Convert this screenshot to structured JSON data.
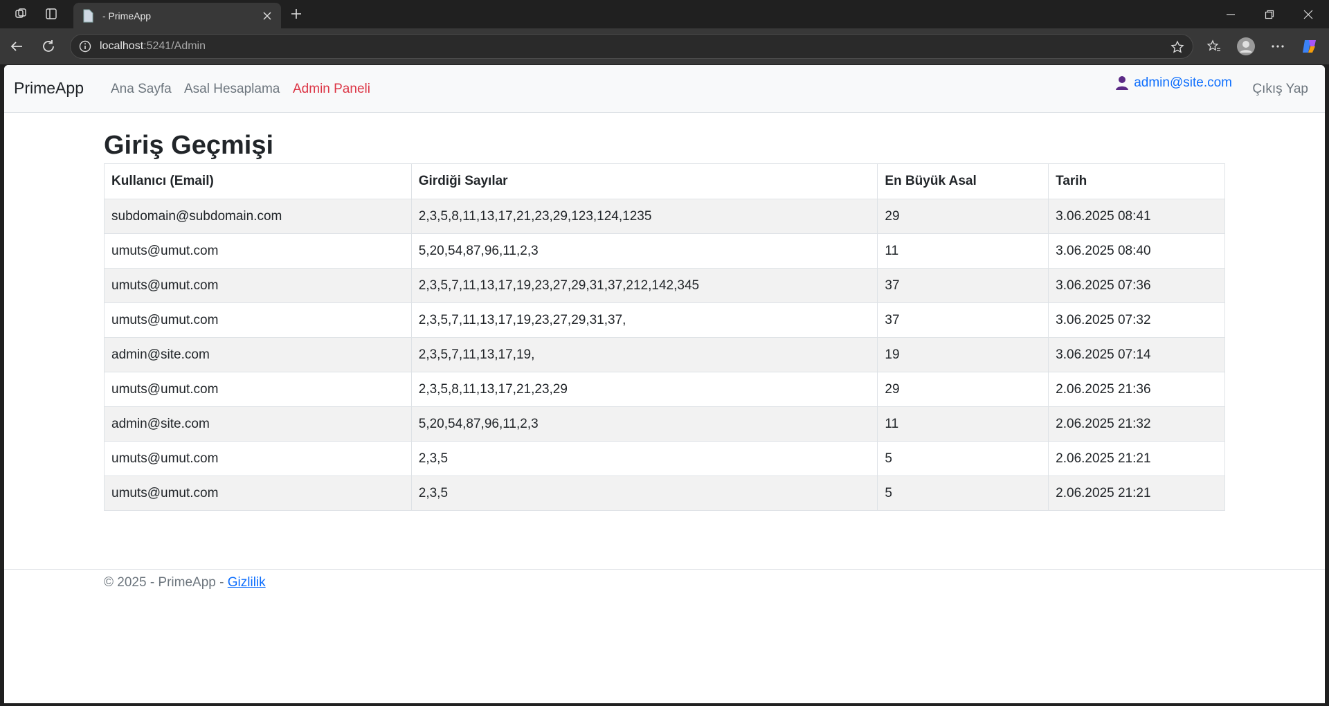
{
  "browser": {
    "tab_title": "- PrimeApp",
    "url_host": "localhost",
    "url_path": ":5241/Admin"
  },
  "navbar": {
    "brand": "PrimeApp",
    "links": [
      {
        "label": "Ana Sayfa",
        "active": false
      },
      {
        "label": "Asal Hesaplama",
        "active": false
      },
      {
        "label": "Admin Paneli",
        "active": true
      }
    ],
    "user_email": "admin@site.com",
    "logout_label": "Çıkış Yap",
    "active_color": "#dc3545",
    "link_color": "#0d6efd"
  },
  "main": {
    "title": "Giriş Geçmişi",
    "table": {
      "headers": [
        "Kullanıcı (Email)",
        "Girdiği Sayılar",
        "En Büyük Asal",
        "Tarih"
      ],
      "rows": [
        [
          "subdomain@subdomain.com",
          "2,3,5,8,11,13,17,21,23,29,123,124,1235",
          "29",
          "3.06.2025 08:41"
        ],
        [
          "umuts@umut.com",
          "5,20,54,87,96,11,2,3",
          "11",
          "3.06.2025 08:40"
        ],
        [
          "umuts@umut.com",
          "2,3,5,7,11,13,17,19,23,27,29,31,37,212,142,345",
          "37",
          "3.06.2025 07:36"
        ],
        [
          "umuts@umut.com",
          "2,3,5,7,11,13,17,19,23,27,29,31,37,",
          "37",
          "3.06.2025 07:32"
        ],
        [
          "admin@site.com",
          "2,3,5,7,11,13,17,19,",
          "19",
          "3.06.2025 07:14"
        ],
        [
          "umuts@umut.com",
          "2,3,5,8,11,13,17,21,23,29",
          "29",
          "2.06.2025 21:36"
        ],
        [
          "admin@site.com",
          "5,20,54,87,96,11,2,3",
          "11",
          "2.06.2025 21:32"
        ],
        [
          "umuts@umut.com",
          "2,3,5",
          "5",
          "2.06.2025 21:21"
        ],
        [
          "umuts@umut.com",
          "2,3,5",
          "5",
          "2.06.2025 21:21"
        ]
      ]
    }
  },
  "footer": {
    "text": "© 2025 - PrimeApp - ",
    "privacy_link": "Gizlilik"
  }
}
